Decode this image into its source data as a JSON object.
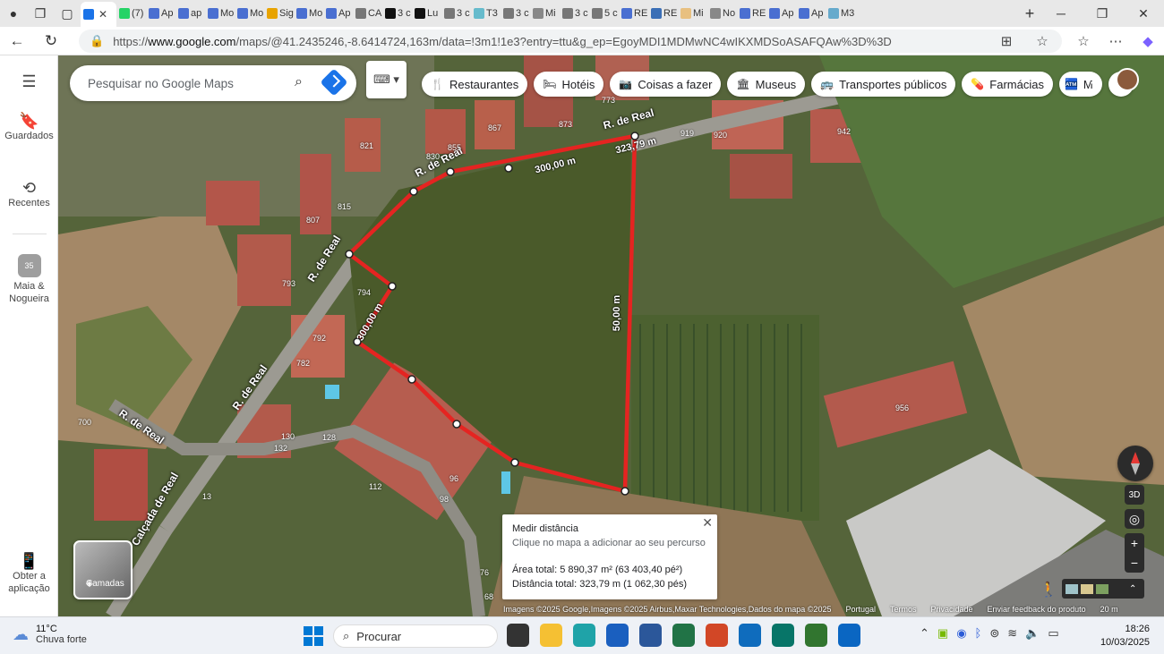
{
  "browser": {
    "tabs": [
      {
        "label": "",
        "fav": "#1a73e8",
        "active": true
      },
      {
        "label": "(7)",
        "fav": "#25d366"
      },
      {
        "label": "Ap",
        "fav": "#4a6fd1"
      },
      {
        "label": "ap",
        "fav": "#4a6fd1"
      },
      {
        "label": "Mo",
        "fav": "#4a6fd1"
      },
      {
        "label": "Mo",
        "fav": "#4a6fd1"
      },
      {
        "label": "Sig",
        "fav": "#e8a300"
      },
      {
        "label": "Mo",
        "fav": "#4a6fd1"
      },
      {
        "label": "Ap",
        "fav": "#4a6fd1"
      },
      {
        "label": "CA",
        "fav": "#777"
      },
      {
        "label": "3 c",
        "fav": "#111"
      },
      {
        "label": "Lu",
        "fav": "#111"
      },
      {
        "label": "3 c",
        "fav": "#777"
      },
      {
        "label": "T3",
        "fav": "#6bc"
      },
      {
        "label": "3 c",
        "fav": "#777"
      },
      {
        "label": "Mi",
        "fav": "#888"
      },
      {
        "label": "3 c",
        "fav": "#777"
      },
      {
        "label": "5 c",
        "fav": "#777"
      },
      {
        "label": "RE",
        "fav": "#4a6fd1"
      },
      {
        "label": "RE",
        "fav": "#3b6fb6"
      },
      {
        "label": "Mi",
        "fav": "#e8c080"
      },
      {
        "label": "No",
        "fav": "#888"
      },
      {
        "label": "RE",
        "fav": "#4a6fd1"
      },
      {
        "label": "Ap",
        "fav": "#4a6fd1"
      },
      {
        "label": "Ap",
        "fav": "#4a6fd1"
      },
      {
        "label": "M3",
        "fav": "#6ac"
      }
    ],
    "url_prefix": "https://",
    "url_host": "www.google.com",
    "url_path": "/maps/@41.2435246,-8.6414724,163m/data=!3m1!1e3?entry=ttu&g_ep=EgoyMDI1MDMwNC4wIKXMDSoASAFQAw%3D%3D"
  },
  "rail": {
    "menu_icon": "menu-icon",
    "saved": "Guardados",
    "recent": "Recentes",
    "place": "Maia & Nogueira",
    "place_badge": "35",
    "get_app": "Obter a aplicação"
  },
  "search": {
    "placeholder": "Pesquisar no Google Maps"
  },
  "chips": [
    {
      "icon": "🍴",
      "label": "Restaurantes"
    },
    {
      "icon": "🛏",
      "label": "Hotéis"
    },
    {
      "icon": "📷",
      "label": "Coisas a fazer"
    },
    {
      "icon": "🏛",
      "label": "Museus"
    },
    {
      "icon": "🚌",
      "label": "Transportes públicos"
    },
    {
      "icon": "💊",
      "label": "Farmácias"
    },
    {
      "icon": "🏧",
      "label": "M"
    }
  ],
  "map": {
    "measure_labels": [
      "300,00 m",
      "323,79 m",
      "50,00 m",
      "300,00 m"
    ],
    "streets": [
      "R. de Real",
      "R. de Real",
      "R. de Real",
      "R. de Real",
      "R. de Real",
      "Calçada de Real"
    ],
    "house_numbers": [
      "821",
      "830",
      "855",
      "867",
      "873",
      "773",
      "919",
      "920",
      "942",
      "815",
      "807",
      "793",
      "794",
      "792",
      "782",
      "700",
      "130",
      "132",
      "128",
      "112",
      "96",
      "98",
      "13",
      "76",
      "68",
      "956"
    ],
    "footer": {
      "imagery": "Imagens ©2025 Google,Imagens ©2025 Airbus,Maxar Technologies,Dados do mapa ©2025",
      "country": "Portugal",
      "terms": "Termos",
      "privacy": "Privacidade",
      "feedback": "Enviar feedback do produto",
      "scale": "20 m"
    },
    "layers_label": "Camadas",
    "btn_3d": "3D"
  },
  "measure": {
    "title": "Medir distância",
    "hint": "Clique no mapa a adicionar ao seu percurso",
    "area": "Área total: 5 890,37 m² (63 403,40 pé²)",
    "distance": "Distância total: 323,79 m (1 062,30 pés)"
  },
  "taskbar": {
    "temp": "11°C",
    "weather": "Chuva forte",
    "search": "Procurar",
    "time": "18:26",
    "date": "10/03/2025",
    "apps": [
      {
        "name": "task-view",
        "color": "#333"
      },
      {
        "name": "file-explorer",
        "color": "#f5c033"
      },
      {
        "name": "edge",
        "color": "#1fa3a8"
      },
      {
        "name": "store",
        "color": "#1a5fbf"
      },
      {
        "name": "word",
        "color": "#2b579a"
      },
      {
        "name": "excel",
        "color": "#217346"
      },
      {
        "name": "powerpoint",
        "color": "#d24726"
      },
      {
        "name": "outlook",
        "color": "#0f6cbd"
      },
      {
        "name": "publisher",
        "color": "#077568"
      },
      {
        "name": "project",
        "color": "#31752f"
      },
      {
        "name": "outlook-new",
        "color": "#0a66c2"
      }
    ]
  }
}
